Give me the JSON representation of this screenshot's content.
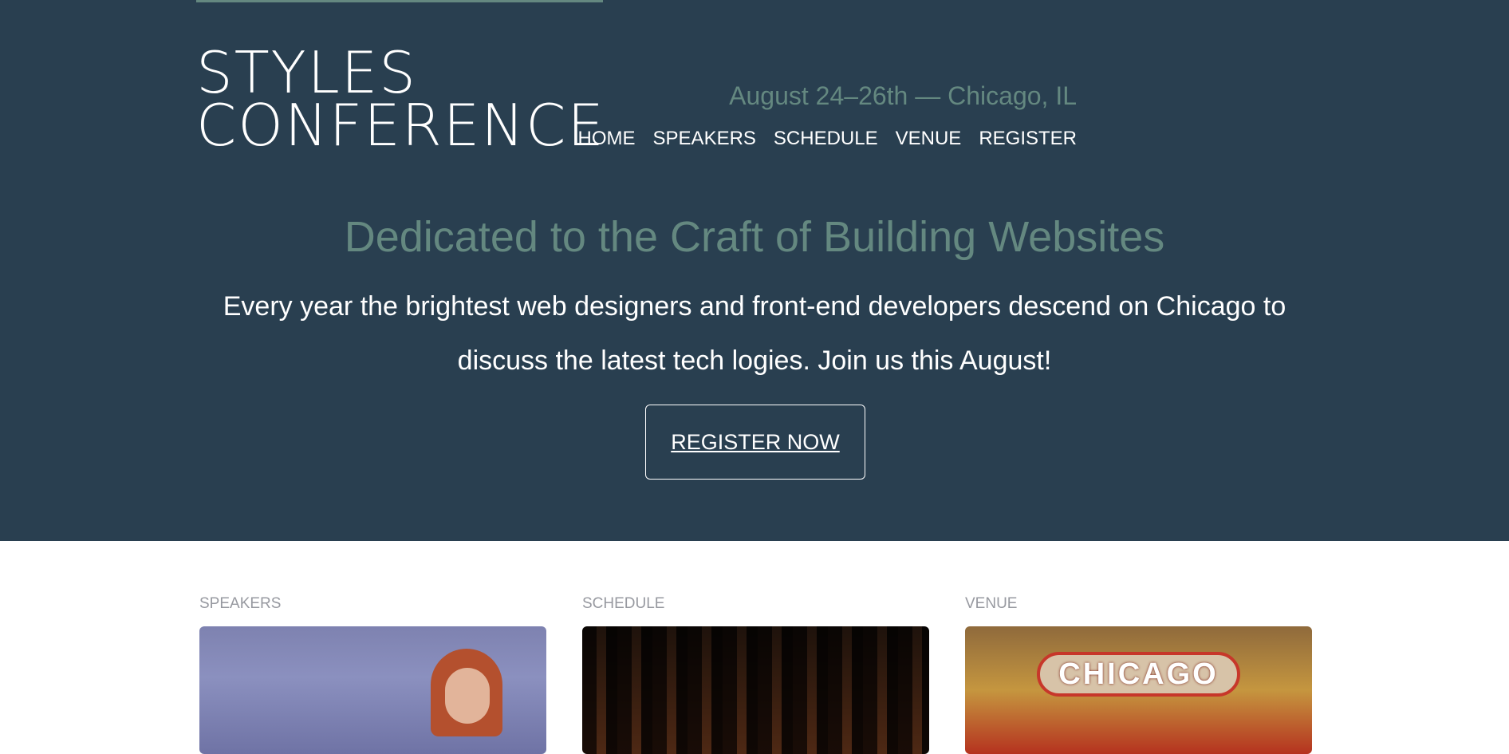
{
  "header": {
    "logo_line1": "STYLES",
    "logo_line2": "CONFERENCE",
    "dates": "August 24–26th — Chicago, IL",
    "nav": [
      "HOME",
      "SPEAKERS",
      "SCHEDULE",
      "VENUE",
      "REGISTER"
    ]
  },
  "hero": {
    "tagline": "Dedicated to the Craft of Building Websites",
    "lead": "Every year the brightest web designers and front-end developers descend on Chicago to discuss the latest tech logies. Join us this August!",
    "cta": "REGISTER NOW"
  },
  "teasers": [
    {
      "label": "SPEAKERS"
    },
    {
      "label": "SCHEDULE"
    },
    {
      "label": "VENUE",
      "sign_text": "CHICAGO"
    }
  ],
  "colors": {
    "hero_bg": "#293f50",
    "accent": "#648880",
    "teaser_label": "#9799a0"
  }
}
